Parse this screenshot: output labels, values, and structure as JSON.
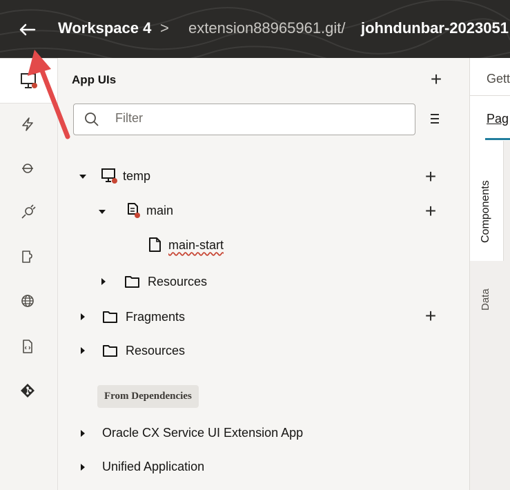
{
  "header": {
    "back_icon": "arrow-left-icon",
    "workspace": "Workspace 4",
    "separator": ">",
    "repo": "extension88965961.git/",
    "branch": "johndunbar-2023051"
  },
  "rail": {
    "icons": [
      "app-uis-icon",
      "events-icon",
      "process-icon",
      "integrations-icon",
      "layouts-icon",
      "web-icon",
      "source-icon",
      "git-icon"
    ],
    "badge_color": "#c74634"
  },
  "panel": {
    "title": "App UIs",
    "filter_placeholder": "Filter",
    "tree": {
      "temp": "temp",
      "main": "main",
      "main_start": "main-start",
      "resources_inner": "Resources",
      "fragments": "Fragments",
      "resources": "Resources"
    },
    "dependencies_label": "From Dependencies",
    "dependencies": [
      "Oracle CX Service UI Extension App",
      "Unified Application"
    ]
  },
  "right": {
    "tab1": "Gett",
    "tab2": "Pag",
    "vtab_components": "Components",
    "vtab_data": "Data",
    "accent": "#227e9e"
  },
  "annotation_color": "#e34a4a"
}
